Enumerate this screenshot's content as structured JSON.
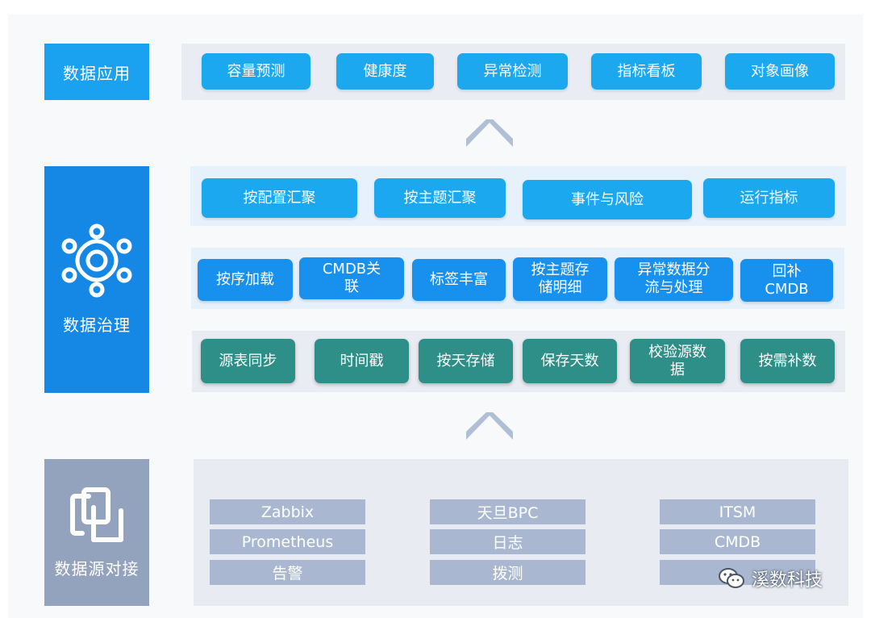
{
  "layers": {
    "application": {
      "label": "数据应用",
      "color": "#1aa1f0"
    },
    "governance": {
      "label": "数据治理",
      "color": "#1588e6",
      "icon": "gear-icon"
    },
    "source": {
      "label": "数据源对接",
      "color": "#94a3bd",
      "icon": "copy-icon"
    }
  },
  "application_items": [
    "容量预测",
    "健康度",
    "异常检测",
    "指标看板",
    "对象画像"
  ],
  "aggregation_items": [
    "按配置汇聚",
    "按主题汇聚",
    "事件与风险",
    "运行指标"
  ],
  "processing_items": [
    "按序加载",
    "CMDB关\n联",
    "标签丰富",
    "按主题存\n储明细",
    "异常数据分\n流与处理",
    "回补\nCMDB"
  ],
  "collection_items": [
    "源表同步",
    "时间戳",
    "按天存储",
    "保存天数",
    "校验源数\n据",
    "按需补数"
  ],
  "sources": {
    "col1": [
      "Zabbix",
      "Prometheus",
      "告警"
    ],
    "col2": [
      "天旦BPC",
      "日志",
      "拨测"
    ],
    "col3": [
      "ITSM",
      "CMDB",
      ""
    ]
  },
  "watermark": {
    "text": "溪数科技",
    "icon": "wechat-icon"
  }
}
